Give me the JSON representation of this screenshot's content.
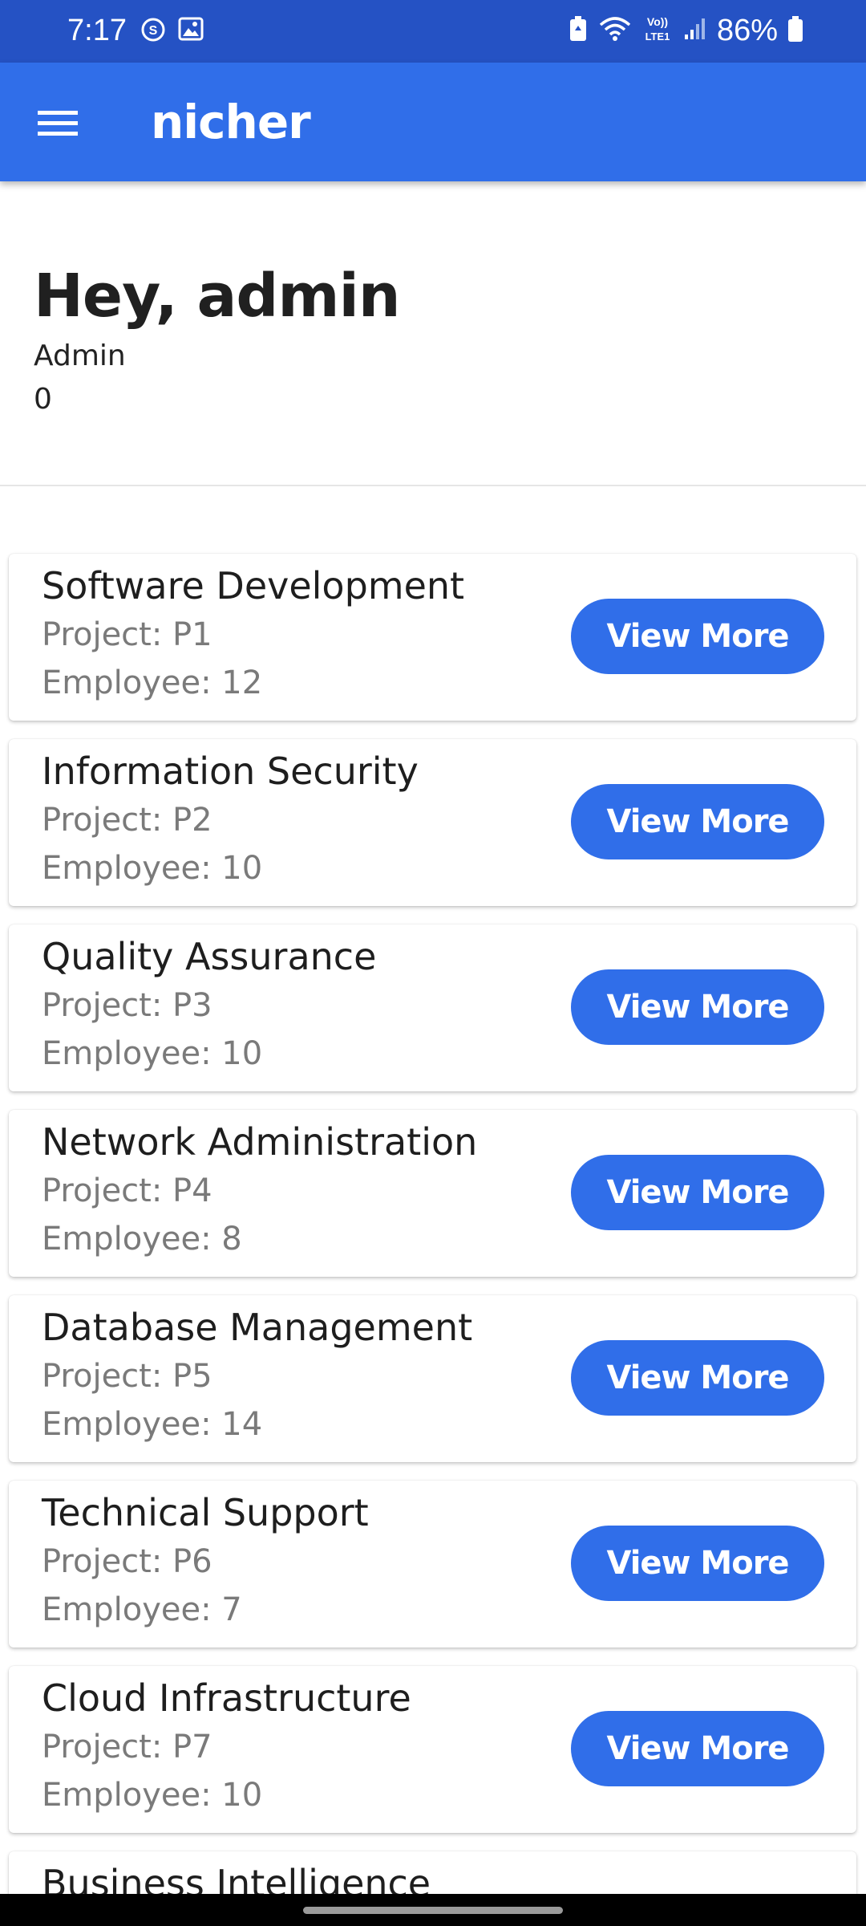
{
  "status_bar": {
    "time": "7:17",
    "battery": "86%",
    "network_label": "LTE1",
    "icons": [
      "sync-icon",
      "image-icon",
      "battery-saver-icon",
      "wifi-icon",
      "volte-icon",
      "signal-icon",
      "battery-icon"
    ]
  },
  "app_bar": {
    "title": "nicher",
    "menu_icon": "hamburger-menu-icon"
  },
  "greeting": {
    "title": "Hey, admin",
    "role": "Admin",
    "count": "0"
  },
  "colors": {
    "primary": "#306ee9",
    "status_bar": "#2552c4",
    "text_primary": "#1e1e1e",
    "text_secondary": "#7a7a7a"
  },
  "departments": [
    {
      "name": "Software Development",
      "project": "Project: P1",
      "employees": "Employee: 12",
      "button": "View More"
    },
    {
      "name": "Information Security",
      "project": "Project: P2",
      "employees": "Employee: 10",
      "button": "View More"
    },
    {
      "name": "Quality Assurance",
      "project": "Project: P3",
      "employees": "Employee: 10",
      "button": "View More"
    },
    {
      "name": "Network Administration",
      "project": "Project: P4",
      "employees": "Employee: 8",
      "button": "View More"
    },
    {
      "name": "Database Management",
      "project": "Project: P5",
      "employees": "Employee: 14",
      "button": "View More"
    },
    {
      "name": "Technical Support",
      "project": "Project: P6",
      "employees": "Employee: 7",
      "button": "View More"
    },
    {
      "name": "Cloud Infrastructure",
      "project": "Project: P7",
      "employees": "Employee: 10",
      "button": "View More"
    },
    {
      "name": "Business Intelligence"
    }
  ]
}
